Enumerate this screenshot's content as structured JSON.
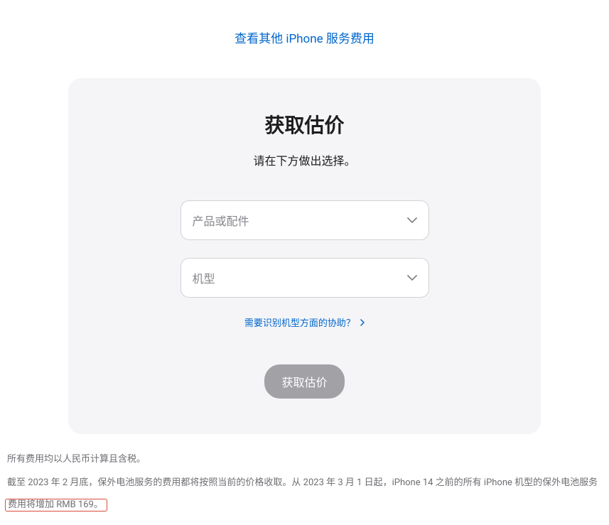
{
  "topLink": {
    "label": "查看其他 iPhone 服务费用"
  },
  "card": {
    "title": "获取估价",
    "subtitle": "请在下方做出选择。",
    "select1": {
      "placeholder": "产品或配件"
    },
    "select2": {
      "placeholder": "机型"
    },
    "helpLink": {
      "label": "需要识别机型方面的协助？"
    },
    "button": {
      "label": "获取估价"
    }
  },
  "footer": {
    "line1": "所有费用均以人民币计算且含税。",
    "line2_part1": "截至 2023 年 2 月底，保外电池服务的费用都将按照当前的价格收取。从 2023 年 3 月 1 日起，iPhone 14 之前的所有 iPhone 机型的保外电池服务",
    "line2_highlight": "费用将增加 RMB 169。"
  }
}
